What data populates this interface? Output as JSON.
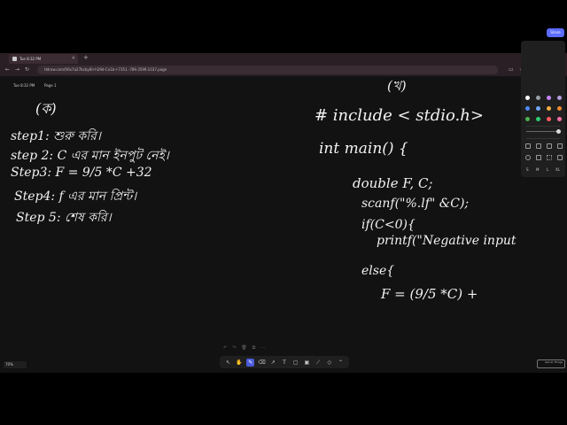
{
  "tab": {
    "label": "Tue 8:32 PM"
  },
  "address": {
    "url": "tldraw.com/f/6x7a27bcby6h-h29d-Cx1b-r-7351.-789.3599.1037.page"
  },
  "canvas_header": {
    "time": "Tue 8:32 PM",
    "page": "Page 1",
    "share_label": "Share"
  },
  "palette": {
    "colors": [
      "#ffffff",
      "#9aa0a6",
      "#c983ff",
      "#b39ddb",
      "#4f8cff",
      "#6fa8ff",
      "#f5b041",
      "#f28b30",
      "#4caf50",
      "#2ecc71",
      "#ff5a5f",
      "#ff6fa8"
    ],
    "sizes": [
      "S",
      "M",
      "L",
      "XL"
    ]
  },
  "zoom_label": "70%",
  "help_label": "Ask AI Things",
  "notes_left": {
    "heading": "(ক)",
    "step1": "step1: শুরু করি।",
    "step2": "step 2: C এর মান ইনপুট নেই।",
    "step3": "Step3: F = 9/5 *C +32",
    "step4": "Step4: f এর মান প্রিন্ট।",
    "step5": "Step 5: শেষ করি।"
  },
  "notes_right": {
    "heading": "(খ)",
    "line1": "# include < stdio.h>",
    "line2": "int main() {",
    "line3": "double F, C;",
    "line4": "scanf(\"%.lf\" &C);",
    "line5": "if(C<0){",
    "line6": "printf(\"Negative input",
    "line7": "else{",
    "line8": "F = (9/5 *C) +"
  }
}
